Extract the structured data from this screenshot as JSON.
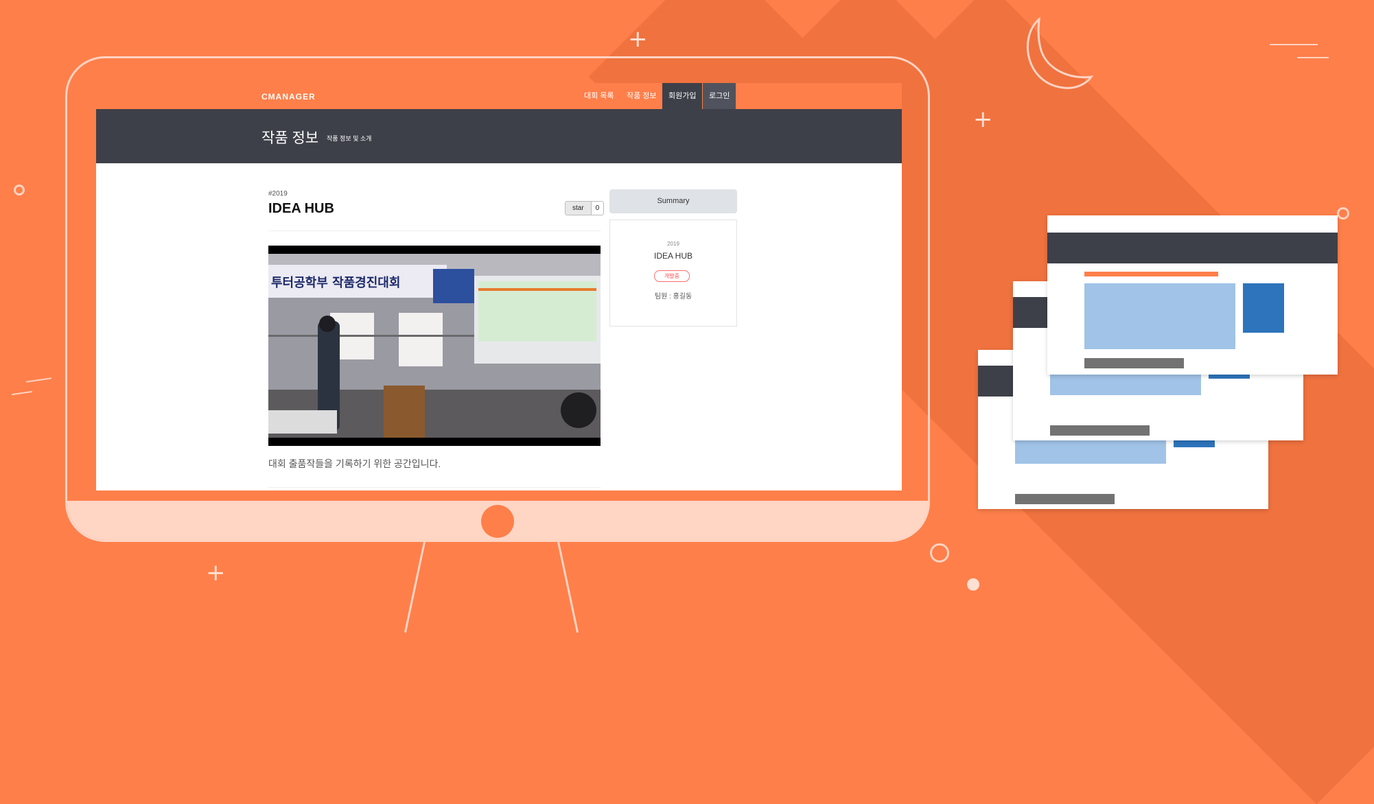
{
  "app": {
    "brand": "CMANAGER",
    "nav": [
      "대회 목록",
      "작품 정보",
      "회원가입",
      "로그인"
    ]
  },
  "banner": {
    "title": "작품 정보",
    "subtitle": "작품 정보 및 소개"
  },
  "project": {
    "year_tag": "#2019",
    "title": "IDEA HUB",
    "star_label": "star",
    "star_count": "0",
    "description": "대회 출품작들을 기록하기 위한 공간입니다.",
    "video_text": "투터공학부 작품경진대회"
  },
  "summary": {
    "button_label": "Summary",
    "year": "2019",
    "title": "IDEA HUB",
    "status_badge": "개발중",
    "team": "팀원 : 홍길동"
  },
  "colors": {
    "accent": "#fe7f4a",
    "banner": "#3e4049",
    "monitor_outline": "#ffd3c2"
  }
}
